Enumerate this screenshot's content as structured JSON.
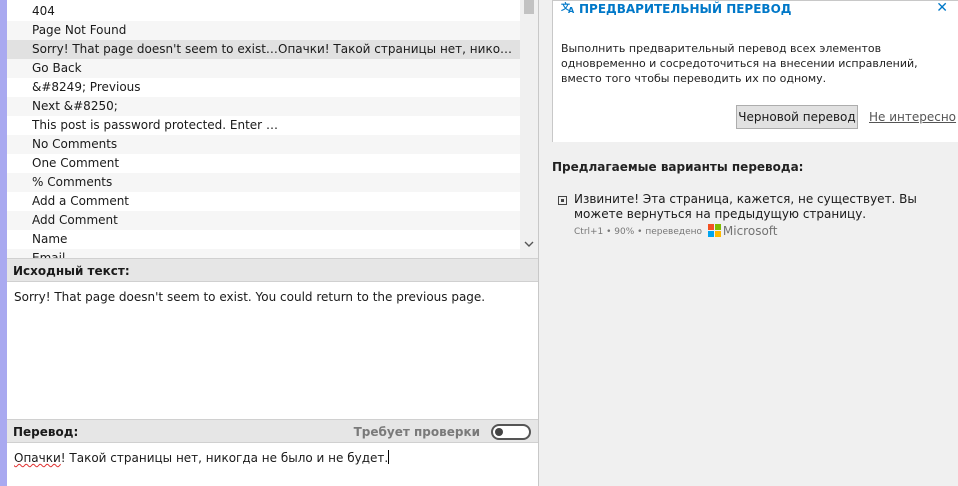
{
  "string_list": [
    {
      "source": "404",
      "translation": ""
    },
    {
      "source": "Page  Not Found",
      "translation": ""
    },
    {
      "source": "Sorry! That page doesn't seem to exist. You ...",
      "translation": "Опачки! Такой страницы нет, никогда не ..."
    },
    {
      "source": "Go Back",
      "translation": ""
    },
    {
      "source": "&#8249; Previous",
      "translation": ""
    },
    {
      "source": "Next &#8250;",
      "translation": ""
    },
    {
      "source": "This post is password protected. Enter the p...",
      "translation": ""
    },
    {
      "source": "No Comments",
      "translation": ""
    },
    {
      "source": "One Comment",
      "translation": ""
    },
    {
      "source": "% Comments",
      "translation": ""
    },
    {
      "source": "Add a Comment",
      "translation": ""
    },
    {
      "source": "Add Comment",
      "translation": ""
    },
    {
      "source": "Name",
      "translation": ""
    },
    {
      "source": "Email",
      "translation": ""
    }
  ],
  "source_panel": {
    "title": "Исходный текст:",
    "text": "Sorry! That page doesn't seem to exist. You could return to the previous page."
  },
  "translation_panel": {
    "title": "Перевод:",
    "needs_review_label": "Требует проверки",
    "needs_review_on": false,
    "text_first_word": "Опачки",
    "text_rest": "! Такой страницы нет, никогда не было и не будет."
  },
  "pretranslate": {
    "title": "ПРЕДВАРИТЕЛЬНЫЙ ПЕРЕВОД",
    "description": "Выполнить предварительный перевод всех элементов одновременно и сосредоточиться на внесении исправлений, вместо того чтобы переводить их по одному.",
    "button_label": "Черновой перевод",
    "dismiss_label": "Не интересно"
  },
  "suggestions": {
    "title": "Предлагаемые варианты перевода:",
    "items": [
      {
        "text": "Извините! Эта страница, кажется, не существует. Вы можете вернуться на предыдущую страницу.",
        "meta": "Ctrl+1 • 90% • переведено",
        "provider": "Microsoft"
      }
    ]
  },
  "colors": {
    "accent_blue": "#0078c8",
    "selected_row": "#e1e1e1",
    "left_accent": "#a9a9f0",
    "ms_red": "#f25022",
    "ms_green": "#7fba00",
    "ms_blue": "#00a4ef",
    "ms_yellow": "#ffb900"
  },
  "icons": {
    "translate": "translate-icon",
    "close": "close-icon",
    "scroll_down": "chevron-down-icon",
    "suggestion": "suggestion-icon",
    "provider_logo": "microsoft-logo-icon"
  }
}
